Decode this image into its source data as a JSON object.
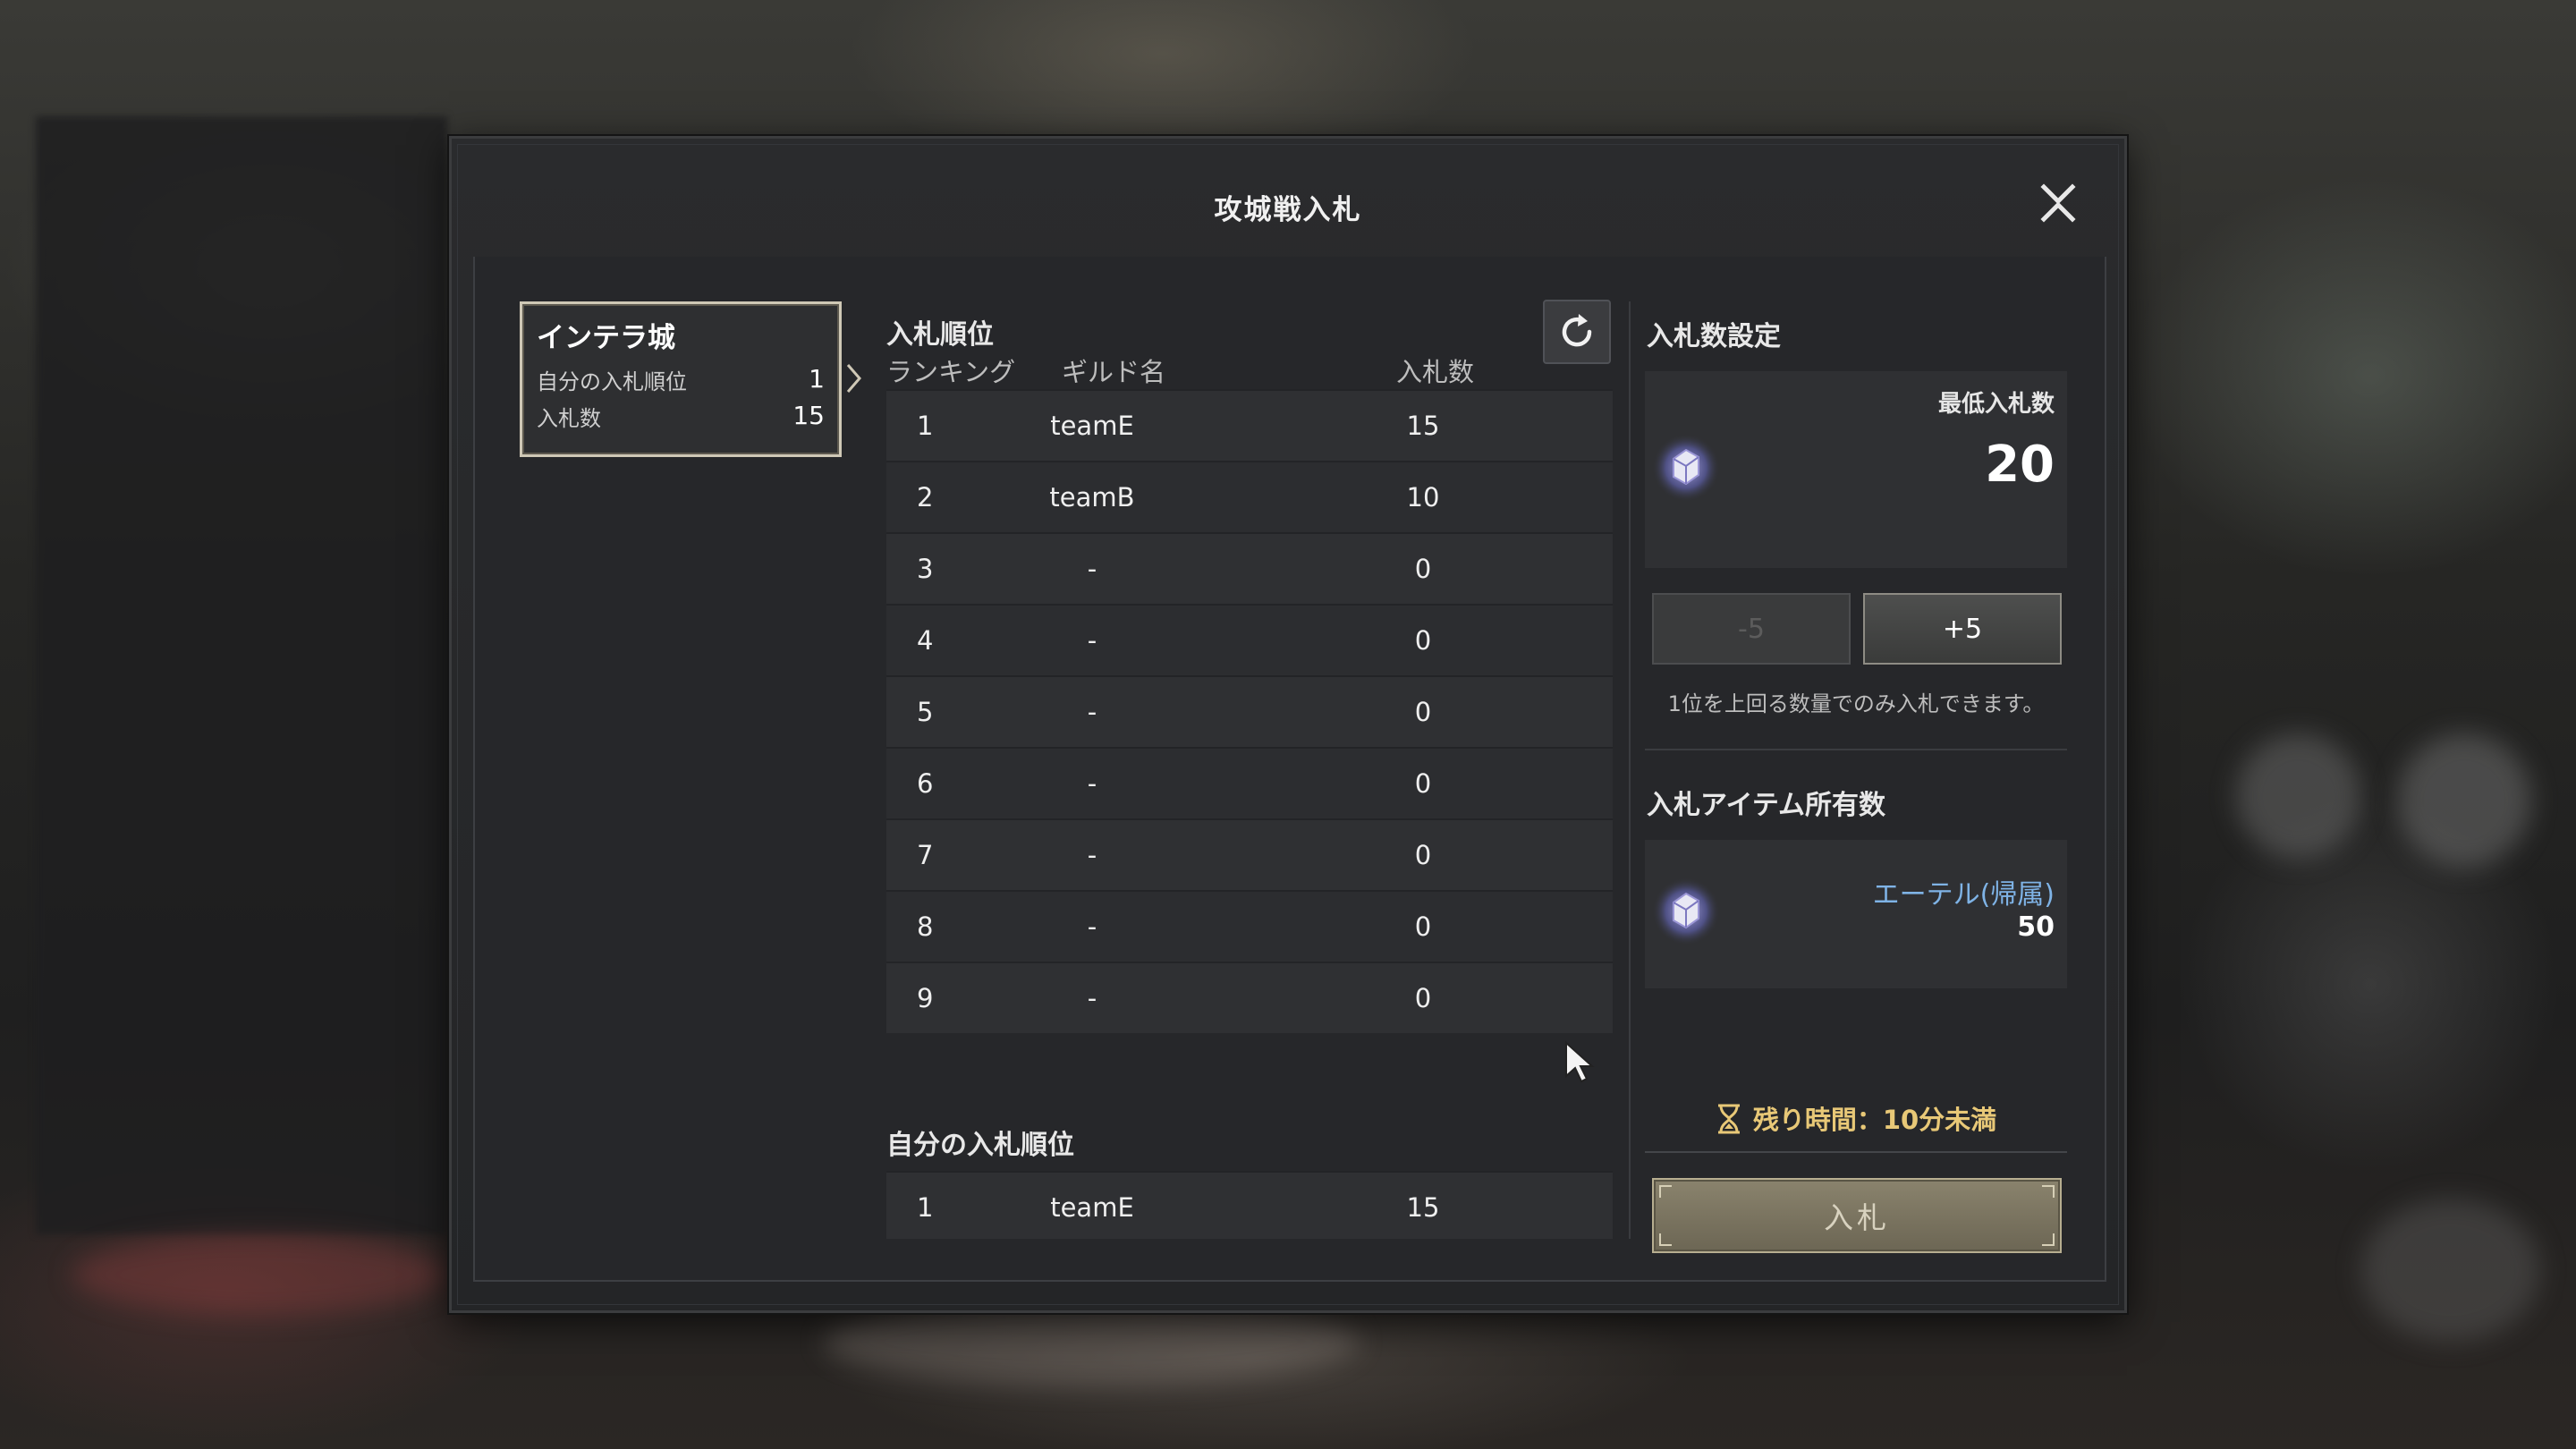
{
  "dialog": {
    "title": "攻城戦入札"
  },
  "castle": {
    "name": "インテラ城",
    "my_rank_label": "自分の入札順位",
    "my_rank_value": "1",
    "bids_label": "入札数",
    "bids_value": "15"
  },
  "ranking": {
    "title": "入札順位",
    "headers": {
      "rank": "ランキング",
      "guild": "ギルド名",
      "bids": "入札数"
    },
    "rows": [
      {
        "rank": "1",
        "guild": "teamE",
        "bids": "15"
      },
      {
        "rank": "2",
        "guild": "teamB",
        "bids": "10"
      },
      {
        "rank": "3",
        "guild": "-",
        "bids": "0"
      },
      {
        "rank": "4",
        "guild": "-",
        "bids": "0"
      },
      {
        "rank": "5",
        "guild": "-",
        "bids": "0"
      },
      {
        "rank": "6",
        "guild": "-",
        "bids": "0"
      },
      {
        "rank": "7",
        "guild": "-",
        "bids": "0"
      },
      {
        "rank": "8",
        "guild": "-",
        "bids": "0"
      },
      {
        "rank": "9",
        "guild": "-",
        "bids": "0"
      }
    ]
  },
  "own_rank": {
    "title": "自分の入札順位",
    "row": {
      "rank": "1",
      "guild": "teamE",
      "bids": "15"
    }
  },
  "bid_settings": {
    "title": "入札数設定",
    "min_label": "最低入札数",
    "min_value": "20",
    "minus_label": "-5",
    "plus_label": "+5",
    "hint": "1位を上回る数量でのみ入札できます。"
  },
  "owned": {
    "title": "入札アイテム所有数",
    "item_name": "エーテル(帰属)",
    "item_count": "50"
  },
  "time": {
    "text": "残り時間：10分未満"
  },
  "bid_button": {
    "label": "入札"
  },
  "icons": [
    "close-icon",
    "refresh-icon",
    "gem-icon",
    "hourglass-icon",
    "chevron-right-icon",
    "cursor-icon"
  ],
  "colors": {
    "accent_gold": "#e8c877",
    "item_blue": "#7fb3e6",
    "button_gold": "#8a836d"
  }
}
